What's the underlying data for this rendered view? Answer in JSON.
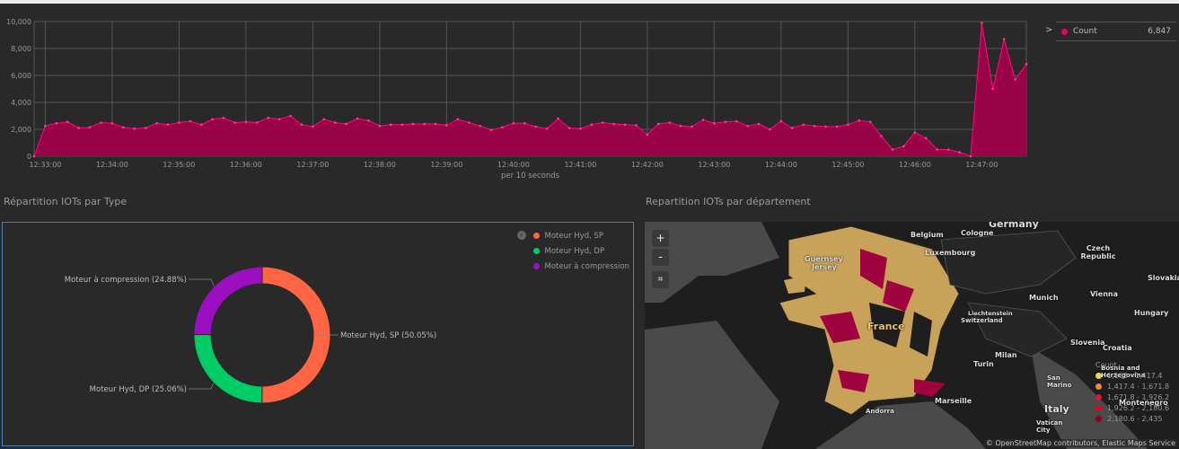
{
  "timeline": {
    "legend": {
      "label": "Count",
      "value": "6,847",
      "color": "#e5006b"
    },
    "x_axis_label": "per 10 seconds"
  },
  "chart_data": [
    {
      "type": "area",
      "title": "",
      "xlabel": "per 10 seconds",
      "ylabel": "",
      "ylim": [
        0,
        10000
      ],
      "yticks": [
        "0",
        "2,000",
        "4,000",
        "6,000",
        "8,000",
        "10,000"
      ],
      "xticks": [
        "12:33:00",
        "12:34:00",
        "12:35:00",
        "12:36:00",
        "12:37:00",
        "12:38:00",
        "12:39:00",
        "12:40:00",
        "12:41:00",
        "12:42:00",
        "12:43:00",
        "12:44:00",
        "12:45:00",
        "12:46:00",
        "12:47:00"
      ],
      "x_start": "12:32:50",
      "x_step_seconds": 10,
      "series": [
        {
          "name": "Count",
          "color": "#e5006b",
          "values": [
            0,
            2250,
            2450,
            2550,
            2100,
            2150,
            2500,
            2450,
            2150,
            2050,
            2100,
            2450,
            2350,
            2500,
            2600,
            2350,
            2750,
            2850,
            2500,
            2550,
            2500,
            2850,
            2750,
            3000,
            2350,
            2200,
            2750,
            2500,
            2400,
            2800,
            2650,
            2250,
            2350,
            2350,
            2400,
            2400,
            2400,
            2300,
            2750,
            2500,
            2250,
            1950,
            2150,
            2450,
            2450,
            2200,
            2050,
            2800,
            2100,
            2050,
            2350,
            2500,
            2400,
            2350,
            2300,
            1600,
            2400,
            2500,
            2250,
            2200,
            2700,
            2450,
            2550,
            2600,
            2250,
            2400,
            2000,
            2600,
            2100,
            2350,
            2250,
            2200,
            2200,
            2350,
            2650,
            2550,
            1500,
            500,
            750,
            1750,
            1350,
            500,
            500,
            300,
            0,
            9900,
            5000,
            8700,
            5700,
            6847
          ]
        }
      ]
    },
    {
      "type": "pie",
      "title": "Répartition IOTs par Type",
      "slices": [
        {
          "label": "Moteur Hyd, SP",
          "value": 50.05,
          "color": "#ff6542",
          "data_label": "Moteur Hyd, SP (50.05%)"
        },
        {
          "label": "Moteur Hyd, DP",
          "value": 25.06,
          "color": "#00cc66",
          "data_label": "Moteur Hyd, DP (25.06%)"
        },
        {
          "label": "Moteur à compression",
          "value": 24.88,
          "color": "#9c0fc0",
          "data_label": "Moteur à compression (24.88%)"
        }
      ]
    }
  ],
  "map": {
    "title": "Repartition IOTs par département",
    "zoom_in": "+",
    "zoom_out": "-",
    "legend_title": "Count",
    "legend": [
      {
        "range": "1,163 - 1,417.4",
        "color": "#f5d547"
      },
      {
        "range": "1,417.4 - 1,671.8",
        "color": "#f58a2a"
      },
      {
        "range": "1,671.8 - 1,926.2",
        "color": "#e8102a"
      },
      {
        "range": "1,926.2 - 2,180.6",
        "color": "#d8081e"
      },
      {
        "range": "2,180.6 - 2,435",
        "color": "#8f0020"
      }
    ],
    "labels": [
      "Germany",
      "Belgium",
      "Cologne",
      "Luxembourg",
      "Guernsey",
      "Jersey",
      "Czech Republic",
      "Slovakia",
      "Munich",
      "Vienna",
      "Hungary",
      "Liechtenstein",
      "Switzerland",
      "France",
      "Slovenia",
      "Croatia",
      "Turin",
      "Milan",
      "Bosnia and Herzegovina",
      "Montenegro",
      "San Marino",
      "Italy",
      "Vatican City",
      "Marseille",
      "Andorra"
    ],
    "attribution": "© OpenStreetMap contributors, Elastic Maps Service"
  }
}
